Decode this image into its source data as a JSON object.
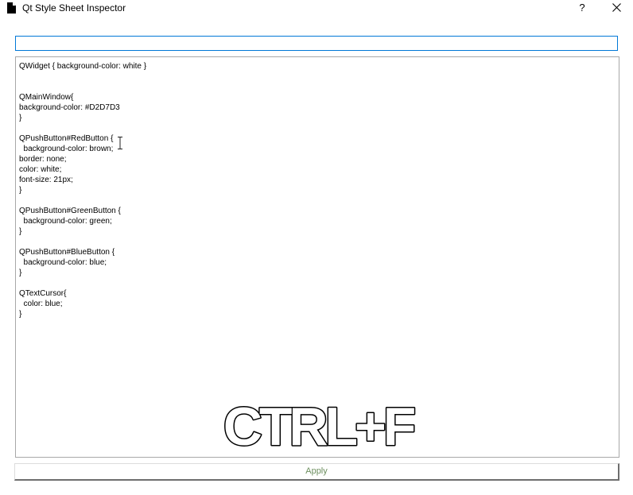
{
  "window": {
    "title": "Qt Style Sheet Inspector",
    "help_label": "?",
    "icons": {
      "app": "document-icon",
      "close": "close-icon",
      "cursor": "text-cursor-icon"
    }
  },
  "search": {
    "value": "",
    "placeholder": ""
  },
  "editor": {
    "content": "QWidget { background-color: white }\n\n\nQMainWindow{\nbackground-color: #D2D7D3\n}\n\nQPushButton#RedButton {\n  background-color: brown;\nborder: none;\ncolor: white;\nfont-size: 21px;\n}\n\nQPushButton#GreenButton {\n  background-color: green;\n}\n\nQPushButton#BlueButton {\n  background-color: blue;\n}\n\nQTextCursor{\n  color: blue;\n}"
  },
  "overlay": {
    "shortcut_text": "CTRL+F"
  },
  "actions": {
    "apply_label": "Apply"
  },
  "colors": {
    "focus_border": "#0078d7",
    "apply_text": "#6d8f5f"
  }
}
